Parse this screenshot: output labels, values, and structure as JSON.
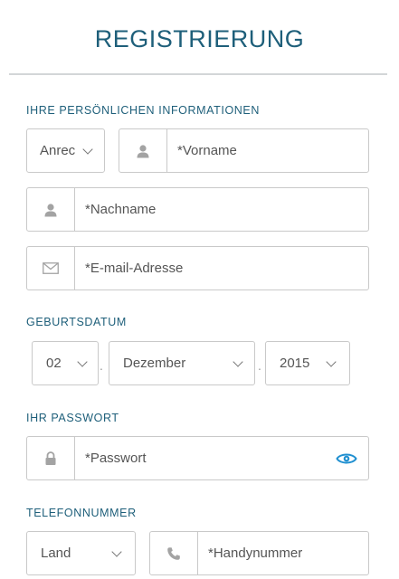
{
  "title": "REGISTRIERUNG",
  "sections": {
    "personal": "IHRE PERSÖNLICHEN INFORMATIONEN",
    "birthdate": "GEBURTSDATUM",
    "password": "IHR PASSWORT",
    "phone": "TELEFONNUMMER"
  },
  "fields": {
    "salutation": "Anrec",
    "firstname_placeholder": "*Vorname",
    "lastname_placeholder": "*Nachname",
    "email_placeholder": "*E-mail-Adresse",
    "password_placeholder": "*Passwort",
    "country": "Land",
    "mobile_placeholder": "*Handynummer"
  },
  "birthdate": {
    "day": "02",
    "month": "Dezember",
    "year": "2015",
    "separator": "."
  },
  "icons": {
    "user": "user-icon",
    "mail": "mail-icon",
    "lock": "lock-icon",
    "eye": "eye-icon",
    "phone": "phone-icon"
  },
  "colors": {
    "accent": "#1e5f7a",
    "eye": "#1f8fd0",
    "border": "#c9c9c9"
  }
}
